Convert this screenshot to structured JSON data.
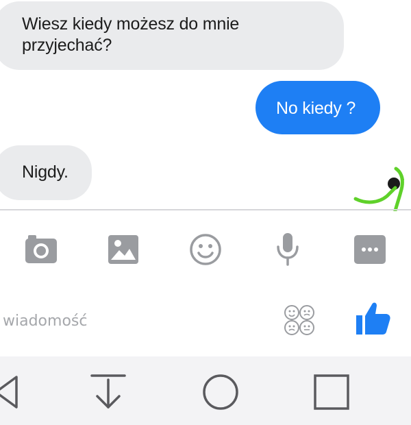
{
  "conversation": {
    "messages": [
      {
        "direction": "incoming",
        "text": "Wiesz kiedy możesz do mnie\nprzyjechać?"
      },
      {
        "direction": "outgoing",
        "text": "No kiedy ?"
      },
      {
        "direction": "incoming",
        "text": "Nigdy."
      }
    ]
  },
  "toolbar": {
    "icons": [
      "camera-icon",
      "gallery-icon",
      "emoji-icon",
      "microphone-icon",
      "more-icon"
    ]
  },
  "composer": {
    "placeholder": "wiadomość",
    "value": "",
    "stickers_icon": "stickers-icon",
    "like_icon": "thumbs-up-icon"
  },
  "navbar": {
    "icons": [
      "back-icon",
      "collapse-keyboard-icon",
      "home-icon",
      "recents-icon"
    ]
  },
  "colors": {
    "outgoing_bubble": "#1e7ff4",
    "incoming_bubble": "#eaebed",
    "icon_gray": "#9a9ca0",
    "accent_blue": "#1e7ff4",
    "annotation_green": "#5fd12a"
  }
}
